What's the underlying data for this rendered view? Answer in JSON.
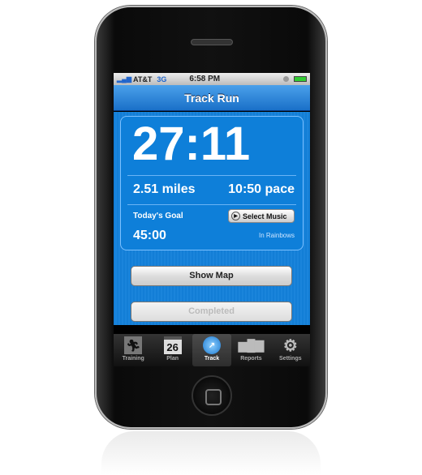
{
  "status": {
    "carrier": "AT&T",
    "network": "3G",
    "time": "6:58 PM"
  },
  "nav": {
    "title": "Track Run"
  },
  "run": {
    "elapsed": "27:11",
    "distance": "2.51 miles",
    "pace": "10:50 pace",
    "goal_label": "Today's Goal",
    "goal_value": "45:00",
    "select_music": "Select Music",
    "album": "In Rainbows"
  },
  "buttons": {
    "show_map": "Show Map",
    "completed": "Completed"
  },
  "tabs": [
    {
      "label": "Training",
      "icon": "runner-icon"
    },
    {
      "label": "Plan",
      "icon": "calendar-icon",
      "value": "26"
    },
    {
      "label": "Track",
      "icon": "stopwatch-icon"
    },
    {
      "label": "Reports",
      "icon": "bar-chart-icon"
    },
    {
      "label": "Settings",
      "icon": "gear-icon"
    }
  ],
  "active_tab": "Track"
}
